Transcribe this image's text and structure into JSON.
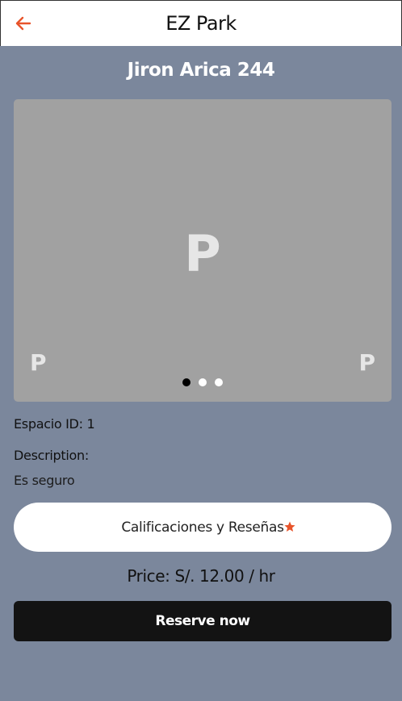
{
  "appbar": {
    "title": "EZ Park",
    "back_icon": "arrow-left-icon",
    "accent": "#e8542b"
  },
  "parking": {
    "title": "Jiron Arica 244",
    "carousel": {
      "image_placeholder_big": "P",
      "image_placeholder_small_left": "P",
      "image_placeholder_small_right": "P",
      "page_count": 3,
      "active_page": 1
    },
    "espacio_label": "Espacio ID: 1",
    "description_label": "Description:",
    "description_value": "Es seguro"
  },
  "ratings_button": {
    "label": "Calificaciones y Reseñas",
    "icon": "star-icon",
    "icon_color": "#e8542b"
  },
  "price_text": "Price: S/. 12.00 / hr",
  "reserve_button": {
    "label": "Reserve now"
  },
  "colors": {
    "background": "#7b879c",
    "carousel_bg": "#a1a1a1",
    "reserve_bg": "#131313"
  }
}
